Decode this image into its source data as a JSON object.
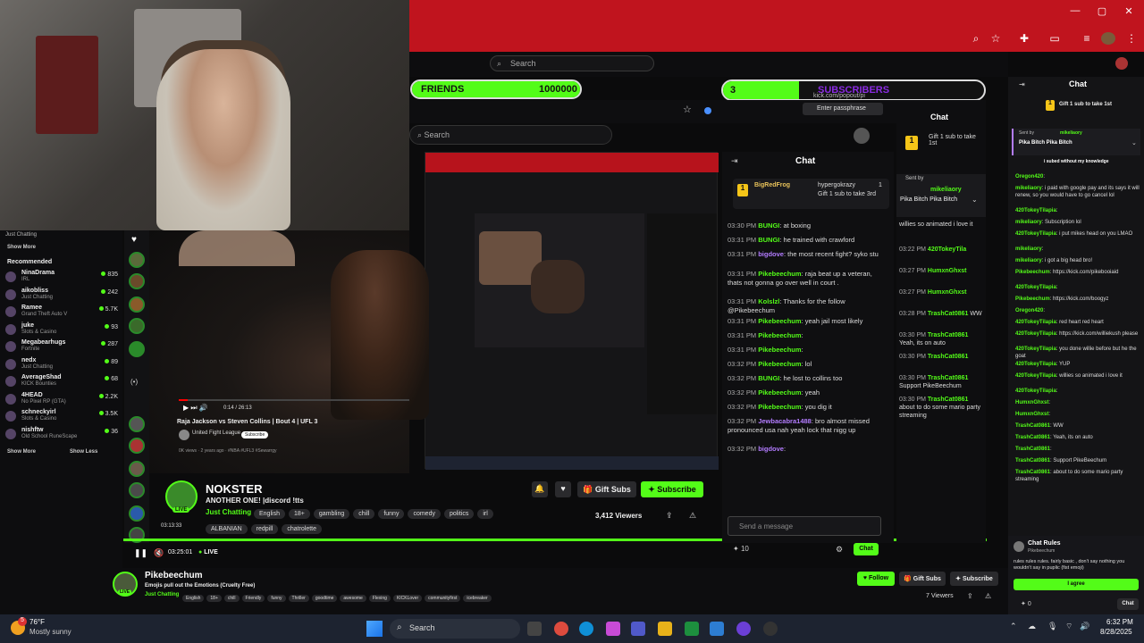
{
  "browser": {
    "search_placeholder": "Search",
    "inner_search_placeholder": "Search",
    "inner_url": "kick.com/popout/pi",
    "inner_pass": "Enter passphrase",
    "window_controls": [
      "—",
      "▢",
      "✕"
    ]
  },
  "goals": {
    "friends_label": "FRIENDS",
    "friends_value": "1000000",
    "subs_count": "3",
    "subs_label": "SUBSCRIBERS"
  },
  "left_panel": {
    "top_category": "Just Chatting",
    "show_more": "Show More",
    "recommended_title": "Recommended",
    "show_more2": "Show More",
    "show_less": "Show Less",
    "items": [
      {
        "name": "NinaDrama",
        "cat": "IRL",
        "viewers": "835"
      },
      {
        "name": "aikobliss",
        "cat": "Just Chatting",
        "viewers": "242"
      },
      {
        "name": "Ramee",
        "cat": "Grand Theft Auto V",
        "viewers": "5.7K"
      },
      {
        "name": "juke",
        "cat": "Slots & Casino",
        "viewers": "93"
      },
      {
        "name": "Megabearhugs",
        "cat": "Fortnite",
        "viewers": "287"
      },
      {
        "name": "nedx",
        "cat": "Just Chatting",
        "viewers": "89"
      },
      {
        "name": "AverageShad",
        "cat": "KICK Bounties",
        "viewers": "68"
      },
      {
        "name": "4HEAD",
        "cat": "No Pixel RP (GTA)",
        "viewers": "2.2K"
      },
      {
        "name": "schneckyirl",
        "cat": "Slots & Casino",
        "viewers": "3.5K"
      },
      {
        "name": "nishftw",
        "cat": "Old School RuneScape",
        "viewers": "36"
      }
    ]
  },
  "video": {
    "yt_title": "Raja Jackson vs Steven Collins | Bout 4 | UFL 3",
    "yt_channel": "United Fight League",
    "yt_subscribe": "Subscribe",
    "yt_time": "0:14 / 26:13",
    "yt_meta": "0K views · 2 years ago · #NBA #UFL3 #Sewarrgy",
    "time_small": "03:13:33",
    "time_elapsed": "03:25:01",
    "live": "LIVE"
  },
  "mid_stream": {
    "name": "NOKSTER",
    "title": "ANOTHER ONE! |discord !tts",
    "category": "Just Chatting",
    "tags": [
      "English",
      "18+",
      "gambling",
      "chill",
      "funny",
      "comedy",
      "politics",
      "irl"
    ],
    "tags2": [
      "ALBANIAN",
      "redpill",
      "chatrolette"
    ],
    "viewers": "3,412 Viewers",
    "gift_subs": "Gift Subs",
    "subscribe": "Subscribe",
    "live_badge": "LIVE"
  },
  "mid_chat": {
    "title": "Chat",
    "pinned_user": "BigRedFrog",
    "pinned_gift_user": "hypergokrazy",
    "pinned_gift_text": "Gift 1 sub to take 3rd",
    "pinned_count": "1",
    "send_placeholder": "Send a message",
    "chat_btn": "Chat",
    "points": "10",
    "messages": [
      {
        "t": "03:30 PM",
        "u": "BUNGI",
        "m": "at boxing"
      },
      {
        "t": "03:31 PM",
        "u": "BUNGI",
        "m": "he trained with crawford"
      },
      {
        "t": "03:31 PM",
        "u": "bigdove",
        "m": "the most recent fight? syko stu"
      },
      {
        "t": "03:31 PM",
        "u": "Pikebeechum",
        "m": "raja beat up a veteran, thats not gonna go over well in court ."
      },
      {
        "t": "03:31 PM",
        "u": "Kolslzl",
        "m": "Thanks for the follow @Pikebeechum"
      },
      {
        "t": "03:31 PM",
        "u": "Pikebeechum",
        "m": "yeah jail most likely"
      },
      {
        "t": "03:31 PM",
        "u": "Pikebeechum",
        "m": ""
      },
      {
        "t": "03:31 PM",
        "u": "Pikebeechum",
        "m": ""
      },
      {
        "t": "03:32 PM",
        "u": "Pikebeechum",
        "m": "lol"
      },
      {
        "t": "03:32 PM",
        "u": "BUNGI",
        "m": "he lost to collins too"
      },
      {
        "t": "03:32 PM",
        "u": "Pikebeechum",
        "m": "yeah"
      },
      {
        "t": "03:32 PM",
        "u": "Pikebeechum",
        "m": "you dig it"
      },
      {
        "t": "03:32 PM",
        "u": "Jewbacabra1488",
        "m": "bro almost missed pronounced usa nah yeah lock that nigg up"
      },
      {
        "t": "03:32 PM",
        "u": "bigdove",
        "m": ""
      }
    ]
  },
  "inner_right_chat": {
    "title": "Chat",
    "gift_text": "Gift 1 sub to take 1st",
    "sent_by": "Sent by",
    "pinned_user": "mikeliaory",
    "pinned_msg": "Pika Bitch Pika Bitch",
    "lines": [
      {
        "t": "",
        "u": "",
        "m": "willies so animated i love it"
      },
      {
        "t": "03:22 PM",
        "u": "420TokeyTila",
        "m": ""
      },
      {
        "t": "03:27 PM",
        "u": "HumxnGhxst",
        "m": ""
      },
      {
        "t": "03:27 PM",
        "u": "HumxnGhxst",
        "m": ""
      },
      {
        "t": "03:28 PM",
        "u": "TrashCat0861",
        "m": "WW"
      },
      {
        "t": "03:30 PM",
        "u": "TrashCat0861",
        "m": "Yeah, its on auto"
      },
      {
        "t": "03:30 PM",
        "u": "TrashCat0861",
        "m": ""
      },
      {
        "t": "03:30 PM",
        "u": "TrashCat0861",
        "m": "Support PikeBeechum"
      },
      {
        "t": "03:30 PM",
        "u": "TrashCat0861",
        "m": "about to do some mario party streaming"
      }
    ]
  },
  "right_chat": {
    "title": "Chat",
    "gift_text": "Gift 1 sub to take 1st",
    "sent_by": "Sent by",
    "pinned_user": "mikeliaory",
    "pinned_msg": "Pika Bitch Pika Bitch",
    "system": "i subed without my knowledge",
    "lines": [
      {
        "u": "Oregon420",
        "m": ""
      },
      {
        "u": "mikeliaory",
        "m": "i paid with google pay and its says it will renew, so you would have to go cancel lol"
      },
      {
        "u": "420TokeyTilapia",
        "m": ""
      },
      {
        "u": "mikeliaory",
        "m": "Subscription lol"
      },
      {
        "u": "420TokeyTilapia",
        "m": "i put mikes head on you LMAO"
      },
      {
        "u": "mikeliaory",
        "m": ""
      },
      {
        "u": "mikeliaory",
        "m": "i got a big head bro!"
      },
      {
        "u": "Pikebeechum",
        "m": "https://kick.com/pikebooiaid"
      },
      {
        "u": "420TokeyTilapia",
        "m": ""
      },
      {
        "u": "Pikebeechum",
        "m": "https://kick.com/boogyz"
      },
      {
        "u": "Oregon420",
        "m": ""
      },
      {
        "u": "420TokeyTilapia",
        "m": "red heart red heart"
      },
      {
        "u": "420TokeyTilapia",
        "m": "https://kick.com/williekush please"
      },
      {
        "u": "420TokeyTilapia",
        "m": "you done willie before but he the goat"
      },
      {
        "u": "420TokeyTilapia",
        "m": "YUP"
      },
      {
        "u": "420TokeyTilapia",
        "m": "willies so animated i love it"
      },
      {
        "u": "420TokeyTilapia",
        "m": ""
      },
      {
        "u": "HumxnGhxst",
        "m": ""
      },
      {
        "u": "HumxnGhxst",
        "m": ""
      },
      {
        "u": "TrashCat0861",
        "m": "WW"
      },
      {
        "u": "TrashCat0861",
        "m": "Yeah, its on auto"
      },
      {
        "u": "TrashCat0861",
        "m": ""
      },
      {
        "u": "TrashCat0861",
        "m": "Support PikeBeechum"
      },
      {
        "u": "TrashCat0861",
        "m": "about to do some mario party streaming"
      }
    ],
    "rules_title": "Chat Rules",
    "rules_user": "Pikebeechum",
    "rules_text": "rules rules rules. fairly basic , don't say nothing you wouldn't say in puplic (fist emoji)",
    "agree": "I agree",
    "send_btn": "Chat",
    "points": "0"
  },
  "main_stream": {
    "name": "Pikebeechum",
    "title": "Emojis pull out the Emotions (Cruelty Free)",
    "category": "Just Chatting",
    "tags": [
      "English",
      "18+",
      "chill",
      "Friendly",
      "funny",
      "Thriller",
      "goodtime",
      "awesome",
      "Flexing",
      "KICKLover",
      "communityfirst",
      "icebreaker"
    ],
    "follow": "Follow",
    "gift_subs": "Gift Subs",
    "subscribe": "Subscribe",
    "viewers": "7 Viewers",
    "live_badge": "LIVE"
  },
  "taskbar": {
    "weather_temp": "76°F",
    "weather_desc": "Mostly sunny",
    "search": "Search",
    "time": "6:32 PM",
    "date": "8/28/2025",
    "notif_count": "5"
  }
}
